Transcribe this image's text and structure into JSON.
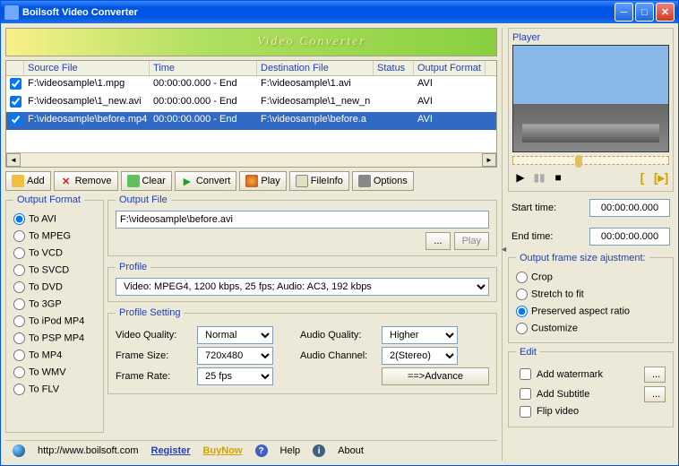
{
  "title": "Boilsoft Video Converter",
  "banner": "Video Converter",
  "filelist": {
    "headers": {
      "src": "Source File",
      "time": "Time",
      "dst": "Destination File",
      "status": "Status",
      "fmt": "Output Format"
    },
    "rows": [
      {
        "chk": true,
        "src": "F:\\videosample\\1.mpg",
        "time": "00:00:00.000 - End",
        "dst": "F:\\videosample\\1.avi",
        "status": "",
        "fmt": "AVI"
      },
      {
        "chk": true,
        "src": "F:\\videosample\\1_new.avi",
        "time": "00:00:00.000 - End",
        "dst": "F:\\videosample\\1_new_n",
        "status": "",
        "fmt": "AVI"
      },
      {
        "chk": true,
        "src": "F:\\videosample\\before.mp4",
        "time": "00:00:00.000 - End",
        "dst": "F:\\videosample\\before.a",
        "status": "",
        "fmt": "AVI",
        "sel": true
      }
    ]
  },
  "toolbar": {
    "add": "Add",
    "remove": "Remove",
    "clear": "Clear",
    "convert": "Convert",
    "play": "Play",
    "fileinfo": "FileInfo",
    "options": "Options"
  },
  "outputFormat": {
    "legend": "Output Format",
    "items": [
      "To AVI",
      "To MPEG",
      "To VCD",
      "To SVCD",
      "To DVD",
      "To 3GP",
      "To iPod MP4",
      "To PSP MP4",
      "To MP4",
      "To WMV",
      "To FLV"
    ],
    "selected": 0
  },
  "outputFile": {
    "legend": "Output File",
    "value": "F:\\videosample\\before.avi",
    "browse": "...",
    "play": "Play"
  },
  "profile": {
    "legend": "Profile",
    "value": "Video: MPEG4, 1200 kbps, 25 fps;  Audio: AC3, 192 kbps"
  },
  "profileSetting": {
    "legend": "Profile Setting",
    "videoQuality": {
      "label": "Video Quality:",
      "value": "Normal"
    },
    "frameSize": {
      "label": "Frame Size:",
      "value": "720x480"
    },
    "frameRate": {
      "label": "Frame Rate:",
      "value": "25 fps"
    },
    "audioQuality": {
      "label": "Audio Quality:",
      "value": "Higher"
    },
    "audioChannel": {
      "label": "Audio Channel:",
      "value": "2(Stereo)"
    },
    "advance": "==>Advance"
  },
  "footer": {
    "url": "http://www.boilsoft.com",
    "register": "Register",
    "buynow": "BuyNow",
    "help": "Help",
    "about": "About"
  },
  "player": {
    "label": "Player",
    "start": {
      "label": "Start time:",
      "value": "00:00:00.000"
    },
    "end": {
      "label": "End  time:",
      "value": "00:00:00.000"
    }
  },
  "frameSize": {
    "legend": "Output frame size ajustment:",
    "items": [
      "Crop",
      "Stretch to fit",
      "Preserved aspect ratio",
      "Customize"
    ],
    "selected": 2
  },
  "edit": {
    "legend": "Edit",
    "watermark": "Add watermark",
    "subtitle": "Add Subtitle",
    "flip": "Flip video"
  }
}
